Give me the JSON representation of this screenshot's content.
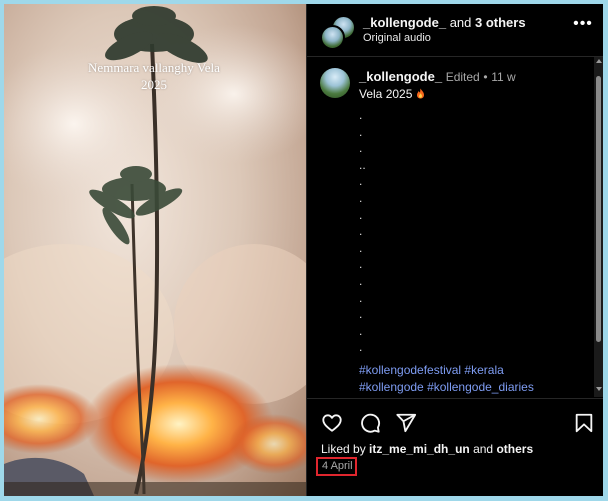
{
  "media": {
    "overlay_title": "Nemmara vallanghy Vela",
    "overlay_year": "2025"
  },
  "header": {
    "username": "_kollengode_",
    "coauthors_text": " and ",
    "coauthors_count": "3 others",
    "audio_label": "Original audio",
    "more_icon": "more-options-icon"
  },
  "caption": {
    "username": "_kollengode_",
    "edited_label": "Edited",
    "separator": "•",
    "age": "11 w",
    "text": "Vela 2025",
    "emoji_icon": "fire-emoji-icon",
    "dot_lines": [
      ".",
      ".",
      ".",
      "..",
      ".",
      ".",
      ".",
      ".",
      ".",
      ".",
      ".",
      ".",
      ".",
      ".",
      ".",
      "."
    ],
    "hashtags": [
      "#kollengodefestival",
      "#kerala",
      "#kollengode",
      "#kollengode_diaries"
    ]
  },
  "actions": {
    "like_icon": "heart-icon",
    "comment_icon": "comment-icon",
    "share_icon": "share-icon",
    "save_icon": "bookmark-icon"
  },
  "likes": {
    "prefix": "Liked by ",
    "user": "itz_me_mi_dh_un",
    "middle": " and ",
    "others": "others"
  },
  "post_date": "4 April",
  "colors": {
    "hashtag": "#7e9cf2",
    "highlight_box": "#e0262e",
    "panel_bg": "#000000",
    "page_bg": "#9fd8ea"
  }
}
